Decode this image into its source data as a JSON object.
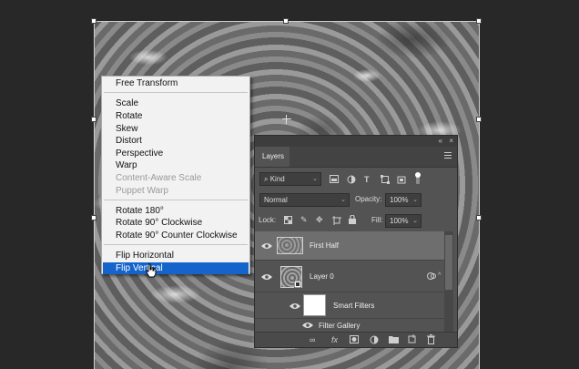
{
  "context_menu": {
    "items": [
      {
        "label": "Free Transform",
        "state": "normal"
      },
      {
        "label": "Scale",
        "state": "normal"
      },
      {
        "label": "Rotate",
        "state": "normal"
      },
      {
        "label": "Skew",
        "state": "normal"
      },
      {
        "label": "Distort",
        "state": "normal"
      },
      {
        "label": "Perspective",
        "state": "normal"
      },
      {
        "label": "Warp",
        "state": "normal"
      },
      {
        "label": "Content-Aware Scale",
        "state": "disabled"
      },
      {
        "label": "Puppet Warp",
        "state": "disabled"
      },
      {
        "label": "Rotate 180°",
        "state": "normal"
      },
      {
        "label": "Rotate 90° Clockwise",
        "state": "normal"
      },
      {
        "label": "Rotate 90° Counter Clockwise",
        "state": "normal"
      },
      {
        "label": "Flip Horizontal",
        "state": "normal"
      },
      {
        "label": "Flip Vertical",
        "state": "selected"
      }
    ]
  },
  "layers_panel": {
    "tab_label": "Layers",
    "collapse_glyph": "«",
    "close_glyph": "×",
    "filter": {
      "label": "Kind",
      "search_glyph": "⌕"
    },
    "blend_mode": "Normal",
    "opacity": {
      "label": "Opacity:",
      "value": "100%"
    },
    "lock": {
      "label": "Lock:"
    },
    "fill": {
      "label": "Fill:",
      "value": "100%"
    },
    "layers": [
      {
        "name": "First Half",
        "selected": true
      },
      {
        "name": "Layer 0",
        "selected": false
      },
      {
        "name": "Smart Filters",
        "selected": false
      },
      {
        "name": "Filter Gallery",
        "selected": false
      }
    ],
    "footer": {
      "fx_label": "fx"
    }
  },
  "colors": {
    "menu_highlight": "#1464cc",
    "panel_bg": "#535353",
    "app_bg": "#282828"
  }
}
